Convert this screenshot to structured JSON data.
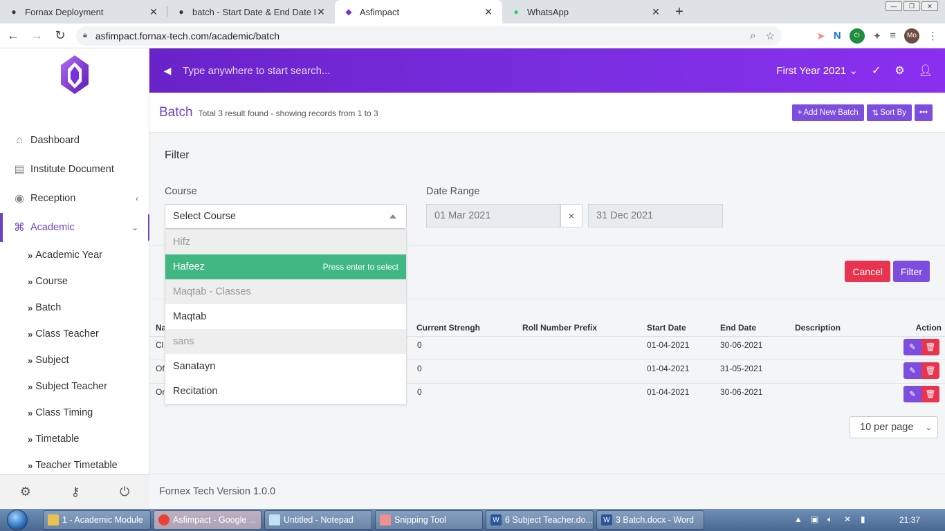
{
  "browser": {
    "tabs": [
      {
        "title": "Fornax Deployment",
        "icon": "github-icon"
      },
      {
        "title": "batch - Start Date & End Date Fil",
        "icon": "github-icon"
      },
      {
        "title": "Asfimpact",
        "icon": "asfimpact-logo-icon"
      },
      {
        "title": "WhatsApp",
        "icon": "whatsapp-icon"
      }
    ],
    "url": "asfimpact.fornax-tech.com/academic/batch",
    "profile": "Mo"
  },
  "sidebar": {
    "items": [
      {
        "label": "Dashboard",
        "icon": "home-icon"
      },
      {
        "label": "Institute Document",
        "icon": "document-icon"
      },
      {
        "label": "Reception",
        "icon": "user-circle-icon"
      },
      {
        "label": "Academic",
        "icon": "university-icon"
      }
    ],
    "subitems": [
      "Academic Year",
      "Course",
      "Batch",
      "Class Teacher",
      "Subject",
      "Subject Teacher",
      "Class Timing",
      "Timetable",
      "Teacher Timetable"
    ]
  },
  "header": {
    "search_placeholder": "Type anywhere to start search...",
    "year": "First Year 2021"
  },
  "page": {
    "title": "Batch",
    "subtitle": "Total 3 result found - showing records from 1 to 3",
    "add_button": "Add New Batch",
    "sort_button": "Sort By"
  },
  "filter": {
    "title": "Filter",
    "course_label": "Course",
    "course_placeholder": "Select Course",
    "date_label": "Date Range",
    "start_date": "01 Mar 2021",
    "end_date": "31 Dec 2021",
    "clear": "×",
    "cancel": "Cancel",
    "submit": "Filter",
    "options": [
      {
        "label": "Hifz",
        "kind": "group"
      },
      {
        "label": "Hafeez",
        "kind": "highlight",
        "hint": "Press enter to select"
      },
      {
        "label": "Maqtab - Classes",
        "kind": "group"
      },
      {
        "label": "Maqtab",
        "kind": "option"
      },
      {
        "label": "sans",
        "kind": "group"
      },
      {
        "label": "Sanatayn",
        "kind": "option"
      },
      {
        "label": "Recitation",
        "kind": "option"
      }
    ]
  },
  "table": {
    "headers": {
      "name": "Na",
      "strength": "Current Strengh",
      "prefix": "Roll Number Prefix",
      "start": "Start Date",
      "end": "End Date",
      "desc": "Description",
      "action": "Action"
    },
    "rows": [
      {
        "name": "Cl",
        "strength": "0",
        "start": "01-04-2021",
        "end": "30-06-2021"
      },
      {
        "name": "Of",
        "strength": "0",
        "start": "01-04-2021",
        "end": "31-05-2021"
      },
      {
        "name": "Or",
        "strength": "0",
        "start": "01-04-2021",
        "end": "30-06-2021"
      }
    ],
    "per_page": "10 per page"
  },
  "footer": "Fornex Tech Version 1.0.0",
  "taskbar": {
    "items": [
      {
        "label": "1 - Academic Module",
        "icon": "folder-icon"
      },
      {
        "label": "Asfimpact - Google ...",
        "icon": "chrome-icon"
      },
      {
        "label": "Untitled - Notepad",
        "icon": "notepad-icon"
      },
      {
        "label": "Snipping Tool",
        "icon": "scissors-icon"
      },
      {
        "label": "6 Subject Teacher.do...",
        "icon": "word-icon"
      },
      {
        "label": "3 Batch.docx - Word",
        "icon": "word-icon"
      }
    ],
    "clock": "21:37"
  },
  "colors": {
    "primary": "#7c4ddf",
    "danger": "#e8344e",
    "success": "#41b883",
    "header_start": "#6a22c9",
    "header_end": "#8b2ff0"
  }
}
